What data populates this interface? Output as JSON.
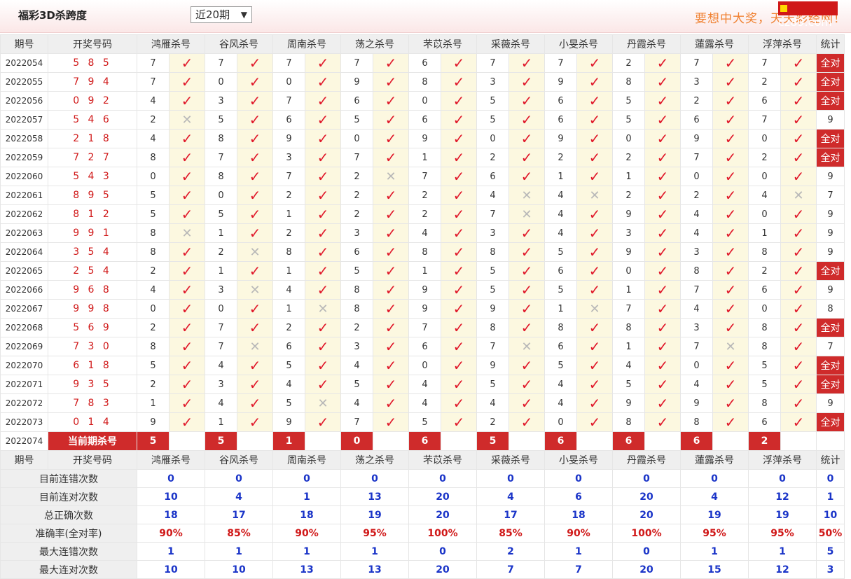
{
  "header": {
    "title": "福彩3D杀跨度",
    "select_value": "近20期",
    "slogan": "要想中大奖，天天彩经网！",
    "logo": "cz89.com"
  },
  "columns": {
    "period": "期号",
    "draw": "开奖号码",
    "experts": [
      "鸿雁杀号",
      "谷风杀号",
      "周南杀号",
      "荡之杀号",
      "芣苡杀号",
      "采薇杀号",
      "小旻杀号",
      "丹霞杀号",
      "蓮露杀号",
      "浮萍杀号"
    ],
    "stat": "统计"
  },
  "marks": {
    "ok": "✓",
    "no": "✕"
  },
  "rows": [
    {
      "period": "2022054",
      "draw": "5 8 5",
      "vals": [
        7,
        7,
        7,
        7,
        6,
        7,
        7,
        2,
        7,
        7
      ],
      "res": "1111111111",
      "stat": "全对"
    },
    {
      "period": "2022055",
      "draw": "7 9 4",
      "vals": [
        7,
        0,
        0,
        9,
        8,
        3,
        9,
        8,
        3,
        2
      ],
      "res": "1111111111",
      "stat": "全对"
    },
    {
      "period": "2022056",
      "draw": "0 9 2",
      "vals": [
        4,
        3,
        7,
        6,
        0,
        5,
        6,
        5,
        2,
        6
      ],
      "res": "1111111111",
      "stat": "全对"
    },
    {
      "period": "2022057",
      "draw": "5 4 6",
      "vals": [
        2,
        5,
        6,
        5,
        6,
        5,
        6,
        5,
        6,
        7
      ],
      "res": "0111111111",
      "stat": "9"
    },
    {
      "period": "2022058",
      "draw": "2 1 8",
      "vals": [
        4,
        8,
        9,
        0,
        9,
        0,
        9,
        0,
        9,
        0
      ],
      "res": "1111111111",
      "stat": "全对"
    },
    {
      "period": "2022059",
      "draw": "7 2 7",
      "vals": [
        8,
        7,
        3,
        7,
        1,
        2,
        2,
        2,
        7,
        2
      ],
      "res": "1111111111",
      "stat": "全对"
    },
    {
      "period": "2022060",
      "draw": "5 4 3",
      "vals": [
        0,
        8,
        7,
        2,
        7,
        6,
        1,
        1,
        0,
        0
      ],
      "res": "1110111111",
      "stat": "9"
    },
    {
      "period": "2022061",
      "draw": "8 9 5",
      "vals": [
        5,
        0,
        2,
        2,
        2,
        4,
        4,
        2,
        2,
        4
      ],
      "res": "1111100110",
      "stat": "7"
    },
    {
      "period": "2022062",
      "draw": "8 1 2",
      "vals": [
        5,
        5,
        1,
        2,
        2,
        7,
        4,
        9,
        4,
        0
      ],
      "res": "1111101111",
      "stat": "9"
    },
    {
      "period": "2022063",
      "draw": "9 9 1",
      "vals": [
        8,
        1,
        2,
        3,
        4,
        3,
        4,
        3,
        4,
        1
      ],
      "res": "0111111111",
      "stat": "9"
    },
    {
      "period": "2022064",
      "draw": "3 5 4",
      "vals": [
        8,
        2,
        8,
        6,
        8,
        8,
        5,
        9,
        3,
        8
      ],
      "res": "1011111111",
      "stat": "9"
    },
    {
      "period": "2022065",
      "draw": "2 5 4",
      "vals": [
        2,
        1,
        1,
        5,
        1,
        5,
        6,
        0,
        8,
        2
      ],
      "res": "1111111111",
      "stat": "全对"
    },
    {
      "period": "2022066",
      "draw": "9 6 8",
      "vals": [
        4,
        3,
        4,
        8,
        9,
        5,
        5,
        1,
        7,
        6
      ],
      "res": "1011111111",
      "stat": "9"
    },
    {
      "period": "2022067",
      "draw": "9 9 8",
      "vals": [
        0,
        0,
        1,
        8,
        9,
        9,
        1,
        7,
        4,
        0
      ],
      "res": "1101110111",
      "stat": "8"
    },
    {
      "period": "2022068",
      "draw": "5 6 9",
      "vals": [
        2,
        7,
        2,
        2,
        7,
        8,
        8,
        8,
        3,
        8
      ],
      "res": "1111111111",
      "stat": "全对"
    },
    {
      "period": "2022069",
      "draw": "7 3 0",
      "vals": [
        8,
        7,
        6,
        3,
        6,
        7,
        6,
        1,
        7,
        8
      ],
      "res": "1011101101",
      "stat": "7"
    },
    {
      "period": "2022070",
      "draw": "6 1 8",
      "vals": [
        5,
        4,
        5,
        4,
        0,
        9,
        5,
        4,
        0,
        5
      ],
      "res": "1111111111",
      "stat": "全对"
    },
    {
      "period": "2022071",
      "draw": "9 3 5",
      "vals": [
        2,
        3,
        4,
        5,
        4,
        5,
        4,
        5,
        4,
        5
      ],
      "res": "1111111111",
      "stat": "全对"
    },
    {
      "period": "2022072",
      "draw": "7 8 3",
      "vals": [
        1,
        4,
        5,
        4,
        4,
        4,
        4,
        9,
        9,
        8
      ],
      "res": "1101111111",
      "stat": "9"
    },
    {
      "period": "2022073",
      "draw": "0 1 4",
      "vals": [
        9,
        1,
        9,
        7,
        5,
        2,
        0,
        8,
        8,
        6
      ],
      "res": "1111111111",
      "stat": "全对"
    }
  ],
  "current": {
    "period": "2022074",
    "label": "当前期杀号",
    "vals": [
      "5",
      "5",
      "1",
      "0",
      "6",
      "5",
      "6",
      "6",
      "6",
      "2"
    ]
  },
  "summary": [
    {
      "label": "目前连错次数",
      "vals": [
        "0",
        "0",
        "0",
        "0",
        "0",
        "0",
        "0",
        "0",
        "0",
        "0"
      ],
      "stat": "0"
    },
    {
      "label": "目前连对次数",
      "vals": [
        "10",
        "4",
        "1",
        "13",
        "20",
        "4",
        "6",
        "20",
        "4",
        "12"
      ],
      "stat": "1"
    },
    {
      "label": "总正确次数",
      "vals": [
        "18",
        "17",
        "18",
        "19",
        "20",
        "17",
        "18",
        "20",
        "19",
        "19"
      ],
      "stat": "10"
    },
    {
      "label": "准确率(全对率)",
      "vals": [
        "90%",
        "85%",
        "90%",
        "95%",
        "100%",
        "85%",
        "90%",
        "100%",
        "95%",
        "95%"
      ],
      "stat": "50%"
    },
    {
      "label": "最大连错次数",
      "vals": [
        "1",
        "1",
        "1",
        "1",
        "0",
        "2",
        "1",
        "0",
        "1",
        "1"
      ],
      "stat": "5"
    },
    {
      "label": "最大连对次数",
      "vals": [
        "10",
        "10",
        "13",
        "13",
        "20",
        "7",
        "7",
        "20",
        "15",
        "12"
      ],
      "stat": "3"
    }
  ]
}
